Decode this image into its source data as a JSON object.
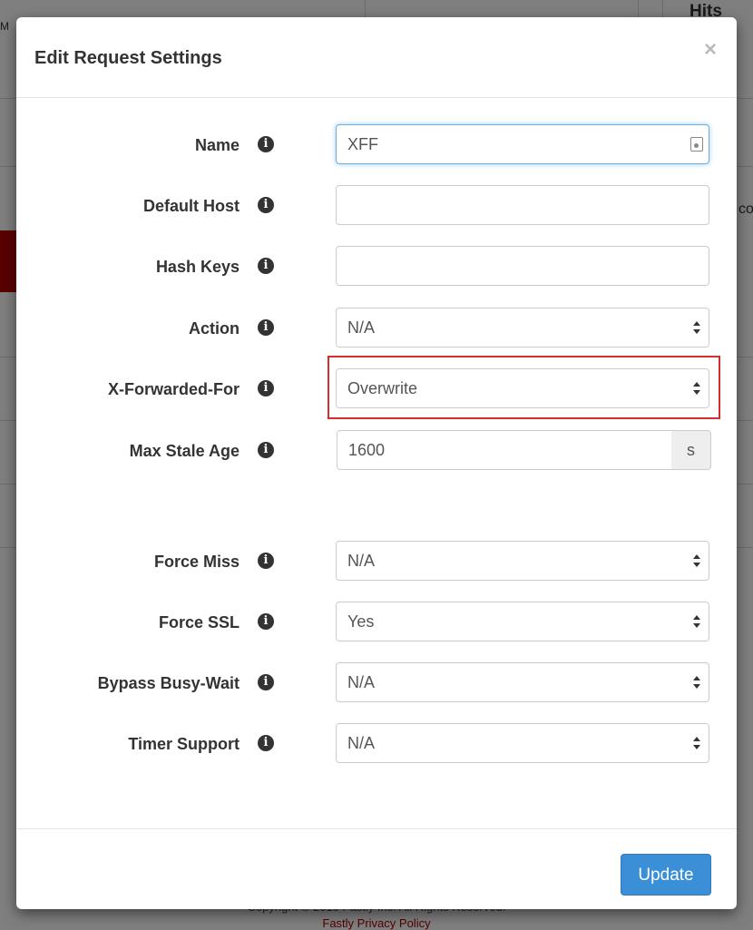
{
  "background": {
    "hits_header": "Hits",
    "column_fragment": "M",
    "text_fragment": "co",
    "footer_text": "Copyright © 2015 Fastly Inc. All Rights Reserved.",
    "privacy_link": "Fastly Privacy Policy"
  },
  "modal": {
    "title": "Edit Request Settings",
    "close_label": "×",
    "fields": {
      "name": {
        "label": "Name",
        "value": "XFF"
      },
      "default_host": {
        "label": "Default Host",
        "value": ""
      },
      "hash_keys": {
        "label": "Hash Keys",
        "value": ""
      },
      "action": {
        "label": "Action",
        "value": "N/A"
      },
      "x_forwarded_for": {
        "label": "X-Forwarded-For",
        "value": "Overwrite"
      },
      "max_stale_age": {
        "label": "Max Stale Age",
        "value": "1600",
        "unit": "s"
      },
      "force_miss": {
        "label": "Force Miss",
        "value": "N/A"
      },
      "force_ssl": {
        "label": "Force SSL",
        "value": "Yes"
      },
      "bypass_busy_wait": {
        "label": "Bypass Busy-Wait",
        "value": "N/A"
      },
      "timer_support": {
        "label": "Timer Support",
        "value": "N/A"
      }
    },
    "info_icon_glyph": "i",
    "update_button": "Update"
  },
  "colors": {
    "primary_button": "#3a8fd6",
    "highlight_border": "#d32f2f",
    "focus_border": "#66afe9"
  }
}
